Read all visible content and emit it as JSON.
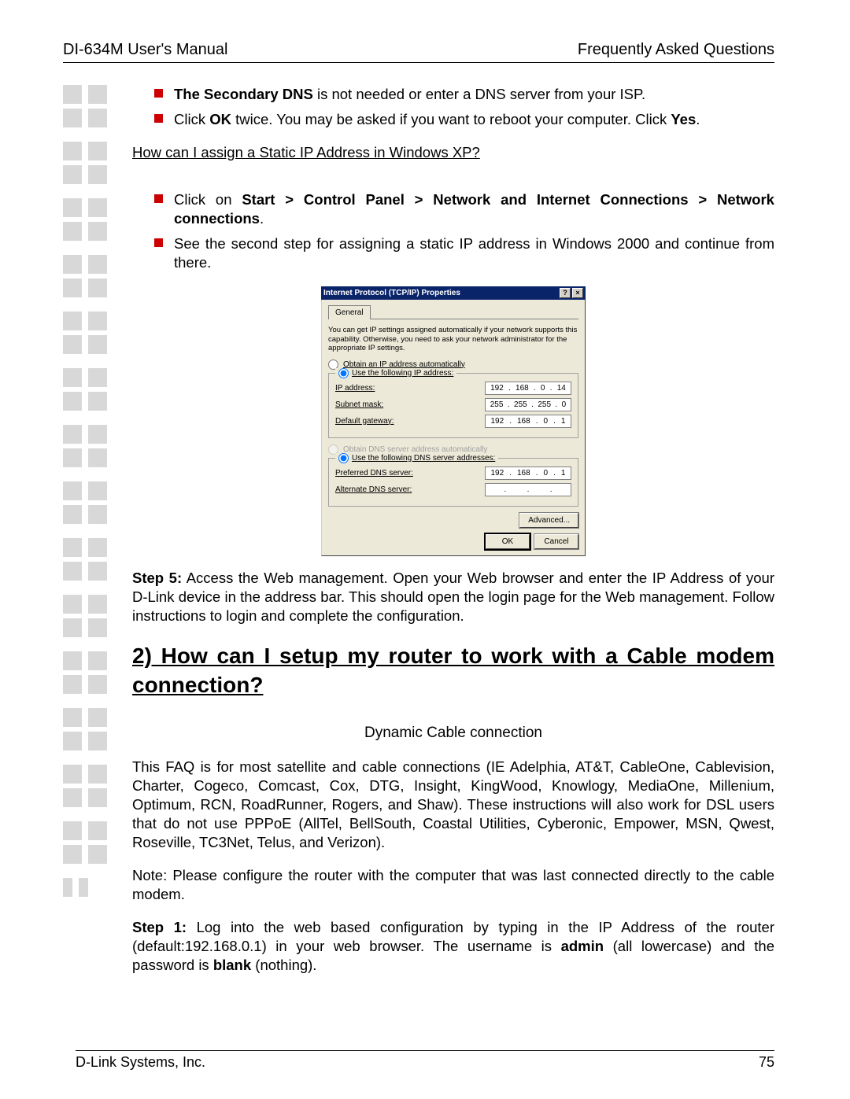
{
  "header": {
    "left": "DI-634M User's Manual",
    "right": "Frequently Asked Questions"
  },
  "top_bullets": {
    "b1_pre": "The Secondary DNS",
    "b1_post": " is not needed or enter a DNS server from your ISP.",
    "b2_a": "Click ",
    "b2_b": "OK",
    "b2_c": " twice. You may be asked if you want to reboot your computer. Click ",
    "b2_d": "Yes",
    "b2_e": "."
  },
  "subq": "How can I assign a Static IP Address in Windows XP?",
  "bullets2": {
    "b1_a": "Click on ",
    "b1_b": "Start > Control Panel > Network and Internet Connections > Network connections",
    "b1_c": ".",
    "b2": "See the second step for assigning a static IP address in Windows 2000 and continue from there."
  },
  "dialog": {
    "title": "Internet Protocol (TCP/IP) Properties",
    "help_btn": "?",
    "close_btn": "×",
    "tab": "General",
    "desc": "You can get IP settings assigned automatically if your network supports this capability. Otherwise, you need to ask your network administrator for the appropriate IP settings.",
    "r1": "Obtain an IP address automatically",
    "r2": "Use the following IP address:",
    "ip_label": "IP address:",
    "ip_val": {
      "a": "192",
      "b": "168",
      "c": "0",
      "d": "14"
    },
    "sm_label": "Subnet mask:",
    "sm_val": {
      "a": "255",
      "b": "255",
      "c": "255",
      "d": "0"
    },
    "gw_label": "Default gateway:",
    "gw_val": {
      "a": "192",
      "b": "168",
      "c": "0",
      "d": "1"
    },
    "r3_disabled": "Obtain DNS server address automatically",
    "r4": "Use the following DNS server addresses:",
    "pdns_label": "Preferred DNS server:",
    "pdns_val": {
      "a": "192",
      "b": "168",
      "c": "0",
      "d": "1"
    },
    "adns_label": "Alternate DNS server:",
    "adv": "Advanced...",
    "ok": "OK",
    "cancel": "Cancel"
  },
  "step5_a": "Step 5:",
  "step5_b": " Access the Web management. Open your Web browser and enter the IP Address of your D-Link device in the address bar. This should open the login page for the Web management. Follow instructions to login and complete the configuration.",
  "q2_title": "2) How can I setup my router to work with a Cable modem connection?",
  "dyn_sub": "Dynamic Cable connection",
  "para1": "This FAQ is for most satellite and cable connections (IE Adelphia, AT&T, CableOne, Cablevision, Charter, Cogeco, Comcast, Cox, DTG, Insight, KingWood, Knowlogy, MediaOne, Millenium, Optimum, RCN, RoadRunner, Rogers, and Shaw). These instructions will also work for DSL users that do not use PPPoE (AllTel, BellSouth, Coastal Utilities, Cyberonic, Empower, MSN, Qwest, Roseville, TC3Net, Telus, and Verizon).",
  "para2": "Note: Please configure the router with the computer that was last connected directly to the cable modem.",
  "step1_a": "Step 1:",
  "step1_b": " Log into the web based configuration by typing in the IP Address of the router (default:192.168.0.1) in your web browser. The username is ",
  "step1_c": "admin",
  "step1_d": " (all lowercase) and the password is ",
  "step1_e": "blank",
  "step1_f": " (nothing).",
  "footer": {
    "left": "D-Link Systems, Inc.",
    "right": "75"
  }
}
